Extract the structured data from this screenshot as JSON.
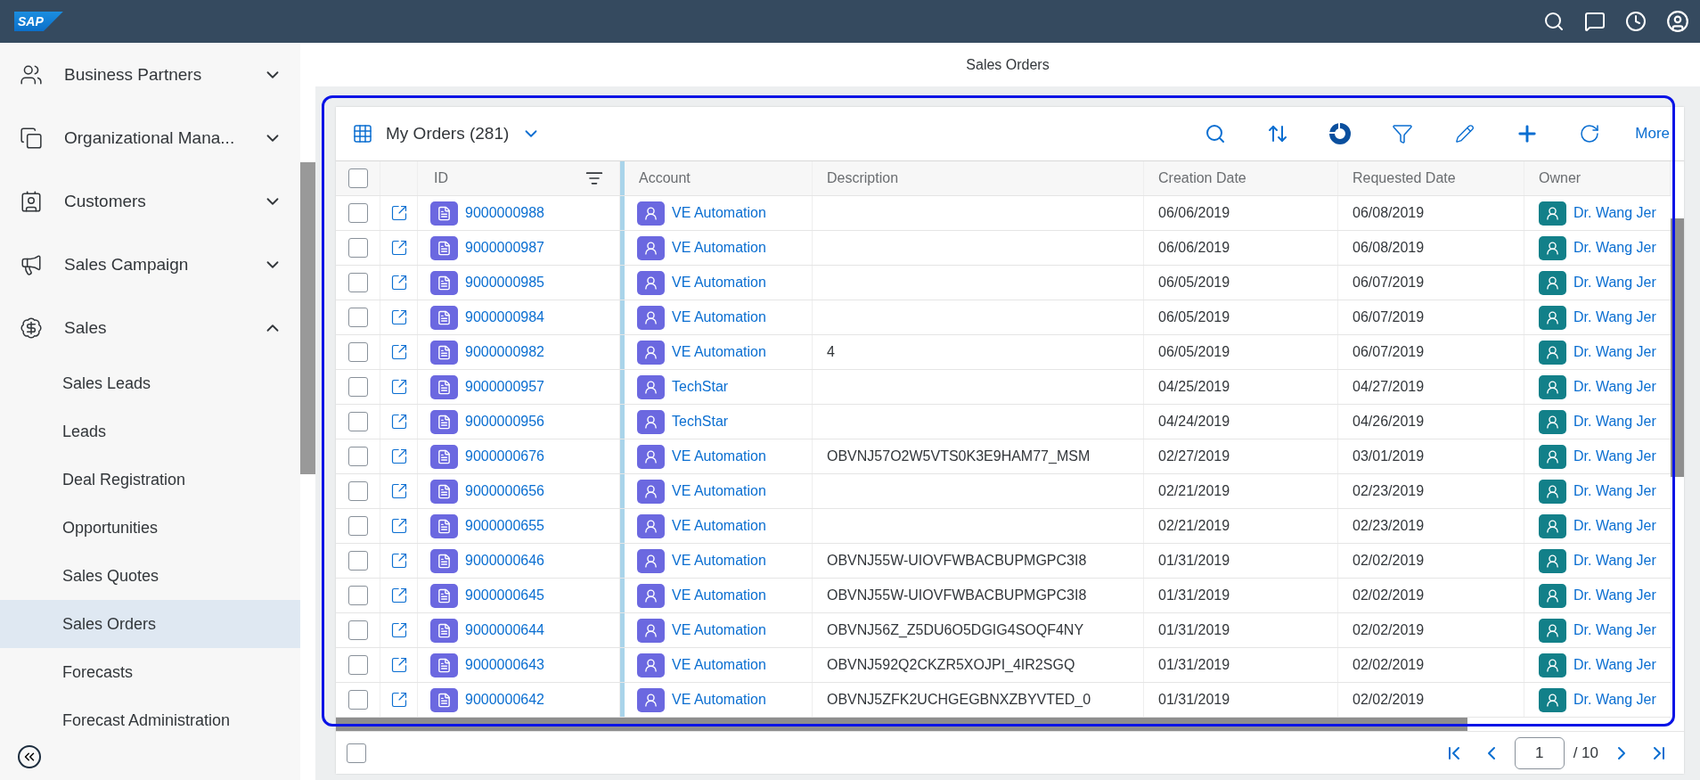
{
  "app": {
    "logo": "SAP"
  },
  "page_title": "Sales Orders",
  "sidebar": {
    "items": [
      {
        "label": "Business Partners",
        "selected": false,
        "expanded": false
      },
      {
        "label": "Organizational Mana...",
        "selected": false,
        "expanded": false
      },
      {
        "label": "Customers",
        "selected": false,
        "expanded": false
      },
      {
        "label": "Sales Campaign",
        "selected": false,
        "expanded": false
      },
      {
        "label": "Sales",
        "selected": false,
        "expanded": true,
        "children": [
          {
            "label": "Sales Leads",
            "selected": false
          },
          {
            "label": "Leads",
            "selected": false
          },
          {
            "label": "Deal Registration",
            "selected": false
          },
          {
            "label": "Opportunities",
            "selected": false
          },
          {
            "label": "Sales Quotes",
            "selected": false
          },
          {
            "label": "Sales Orders",
            "selected": true
          },
          {
            "label": "Forecasts",
            "selected": false
          },
          {
            "label": "Forecast Administration",
            "selected": false
          }
        ]
      }
    ]
  },
  "table": {
    "view": "My Orders",
    "count": "(281)",
    "more": "More",
    "select_all": {
      "checked": false
    },
    "columns": [
      "ID",
      "Account",
      "Description",
      "Creation Date",
      "Requested Date",
      "Owner"
    ],
    "rows": [
      {
        "checked": false,
        "id": "9000000988",
        "account": "VE Automation",
        "description": "",
        "created": "06/06/2019",
        "requested": "06/08/2019",
        "owner": "Dr. Wang Jer"
      },
      {
        "checked": false,
        "id": "9000000987",
        "account": "VE Automation",
        "description": "",
        "created": "06/06/2019",
        "requested": "06/08/2019",
        "owner": "Dr. Wang Jer"
      },
      {
        "checked": false,
        "id": "9000000985",
        "account": "VE Automation",
        "description": "",
        "created": "06/05/2019",
        "requested": "06/07/2019",
        "owner": "Dr. Wang Jer"
      },
      {
        "checked": false,
        "id": "9000000984",
        "account": "VE Automation",
        "description": "",
        "created": "06/05/2019",
        "requested": "06/07/2019",
        "owner": "Dr. Wang Jer"
      },
      {
        "checked": false,
        "id": "9000000982",
        "account": "VE Automation",
        "description": "4",
        "created": "06/05/2019",
        "requested": "06/07/2019",
        "owner": "Dr. Wang Jer"
      },
      {
        "checked": false,
        "id": "9000000957",
        "account": "TechStar",
        "description": "",
        "created": "04/25/2019",
        "requested": "04/27/2019",
        "owner": "Dr. Wang Jer"
      },
      {
        "checked": false,
        "id": "9000000956",
        "account": "TechStar",
        "description": "",
        "created": "04/24/2019",
        "requested": "04/26/2019",
        "owner": "Dr. Wang Jer"
      },
      {
        "checked": false,
        "id": "9000000676",
        "account": "VE Automation",
        "description": "OBVNJ57O2W5VTS0K3E9HAM77_MSM",
        "created": "02/27/2019",
        "requested": "03/01/2019",
        "owner": "Dr. Wang Jer"
      },
      {
        "checked": false,
        "id": "9000000656",
        "account": "VE Automation",
        "description": "",
        "created": "02/21/2019",
        "requested": "02/23/2019",
        "owner": "Dr. Wang Jer"
      },
      {
        "checked": false,
        "id": "9000000655",
        "account": "VE Automation",
        "description": "",
        "created": "02/21/2019",
        "requested": "02/23/2019",
        "owner": "Dr. Wang Jer"
      },
      {
        "checked": false,
        "id": "9000000646",
        "account": "VE Automation",
        "description": "OBVNJ55W-UIOVFWBACBUPMGPC3I8",
        "created": "01/31/2019",
        "requested": "02/02/2019",
        "owner": "Dr. Wang Jer"
      },
      {
        "checked": false,
        "id": "9000000645",
        "account": "VE Automation",
        "description": "OBVNJ55W-UIOVFWBACBUPMGPC3I8",
        "created": "01/31/2019",
        "requested": "02/02/2019",
        "owner": "Dr. Wang Jer"
      },
      {
        "checked": false,
        "id": "9000000644",
        "account": "VE Automation",
        "description": "OBVNJ56Z_Z5DU6O5DGIG4SOQF4NY",
        "created": "01/31/2019",
        "requested": "02/02/2019",
        "owner": "Dr. Wang Jer"
      },
      {
        "checked": false,
        "id": "9000000643",
        "account": "VE Automation",
        "description": "OBVNJ592Q2CKZR5XOJPI_4IR2SGQ",
        "created": "01/31/2019",
        "requested": "02/02/2019",
        "owner": "Dr. Wang Jer"
      },
      {
        "checked": false,
        "id": "9000000642",
        "account": "VE Automation",
        "description": "OBVNJ5ZFK2UCHGEGBNXZBYVTED_0",
        "created": "01/31/2019",
        "requested": "02/02/2019",
        "owner": "Dr. Wang Jer"
      }
    ]
  },
  "footer": {
    "select_all": {
      "checked": false
    }
  },
  "pagination": {
    "page": "1",
    "total": "/ 10"
  }
}
